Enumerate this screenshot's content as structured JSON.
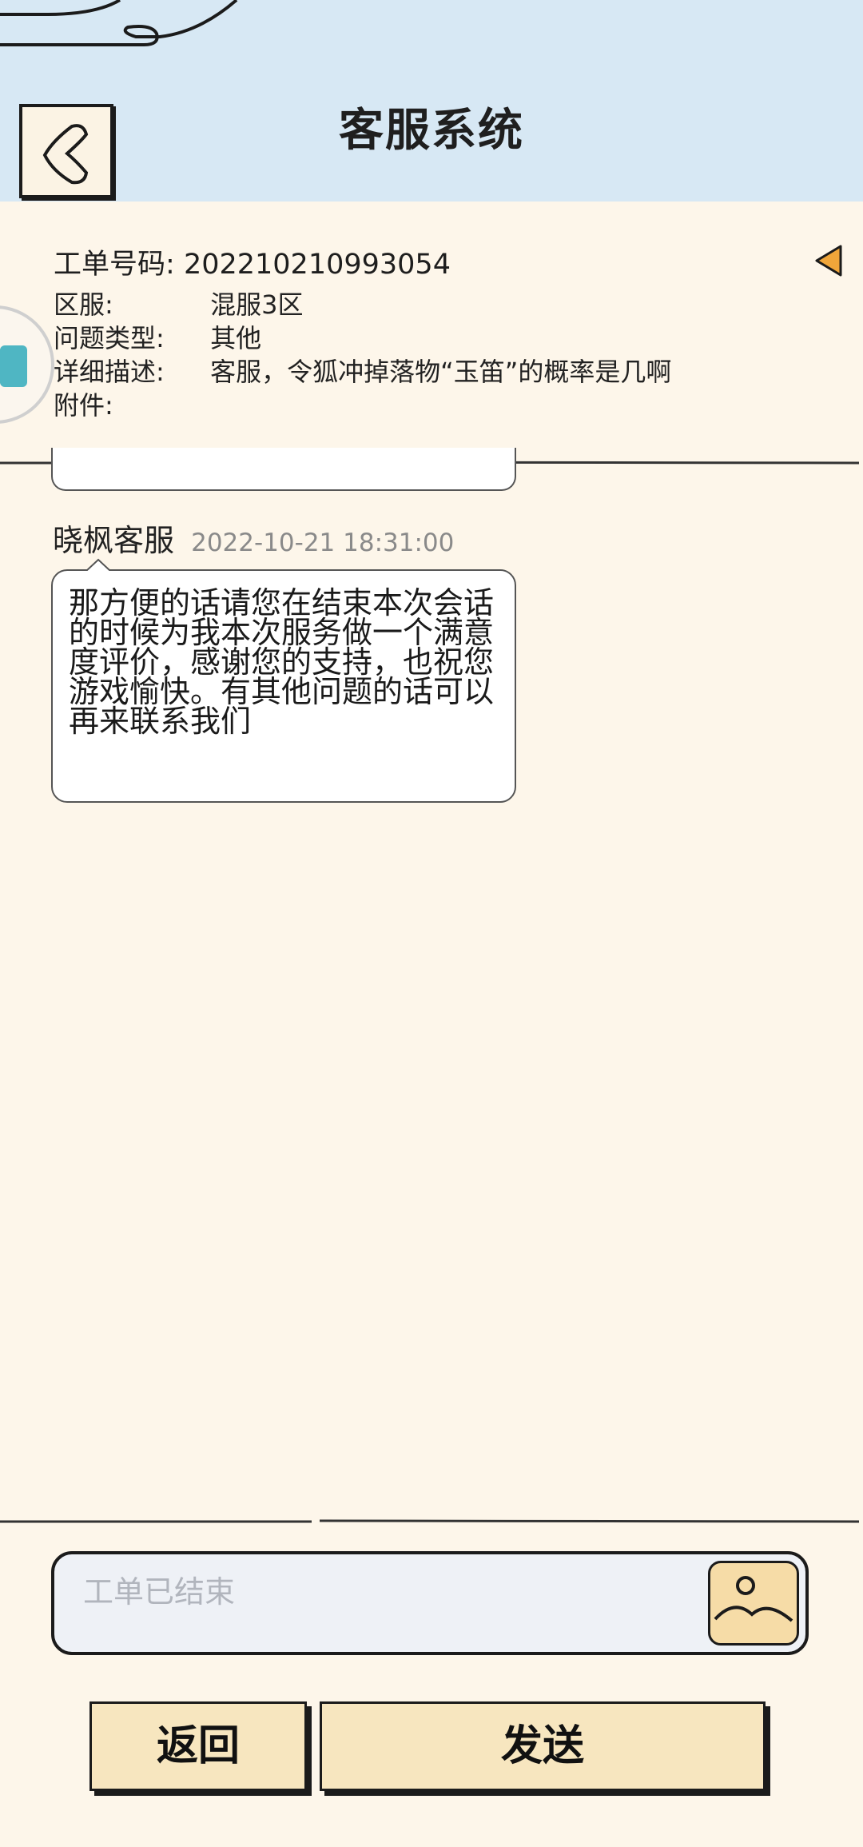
{
  "header": {
    "title": "客服系统"
  },
  "ticket": {
    "id_label": "工单号码:",
    "id_value": "202210210993054",
    "fields": [
      {
        "label": "区服:",
        "value": "混服3区"
      },
      {
        "label": "问题类型:",
        "value": "其他"
      },
      {
        "label": "详细描述:",
        "value": "客服，令狐冲掉落物“玉笛”的概率是几啊"
      },
      {
        "label": "附件:",
        "value": ""
      }
    ]
  },
  "chat": {
    "messages": [
      {
        "sender": "晓枫客服",
        "time": "2022-10-21 18:31:00",
        "text": "那方便的话请您在结束本次会话的时候为我本次服务做一个满意度评价，感谢您的支持，也祝您游戏愉快。有其他问题的话可以再来联系我们"
      }
    ]
  },
  "composer": {
    "placeholder": "工单已结束"
  },
  "buttons": {
    "back_label": "返回",
    "send_label": "发送"
  },
  "colors": {
    "header_bg": "#d7e8f4",
    "page_bg": "#fdf6ea",
    "button_bg": "#f7e6bf",
    "accent_arrow": "#f0a63a"
  },
  "icons": {
    "back": "back-chevron-icon",
    "collapse": "triangle-left-icon",
    "image": "image-upload-icon"
  }
}
